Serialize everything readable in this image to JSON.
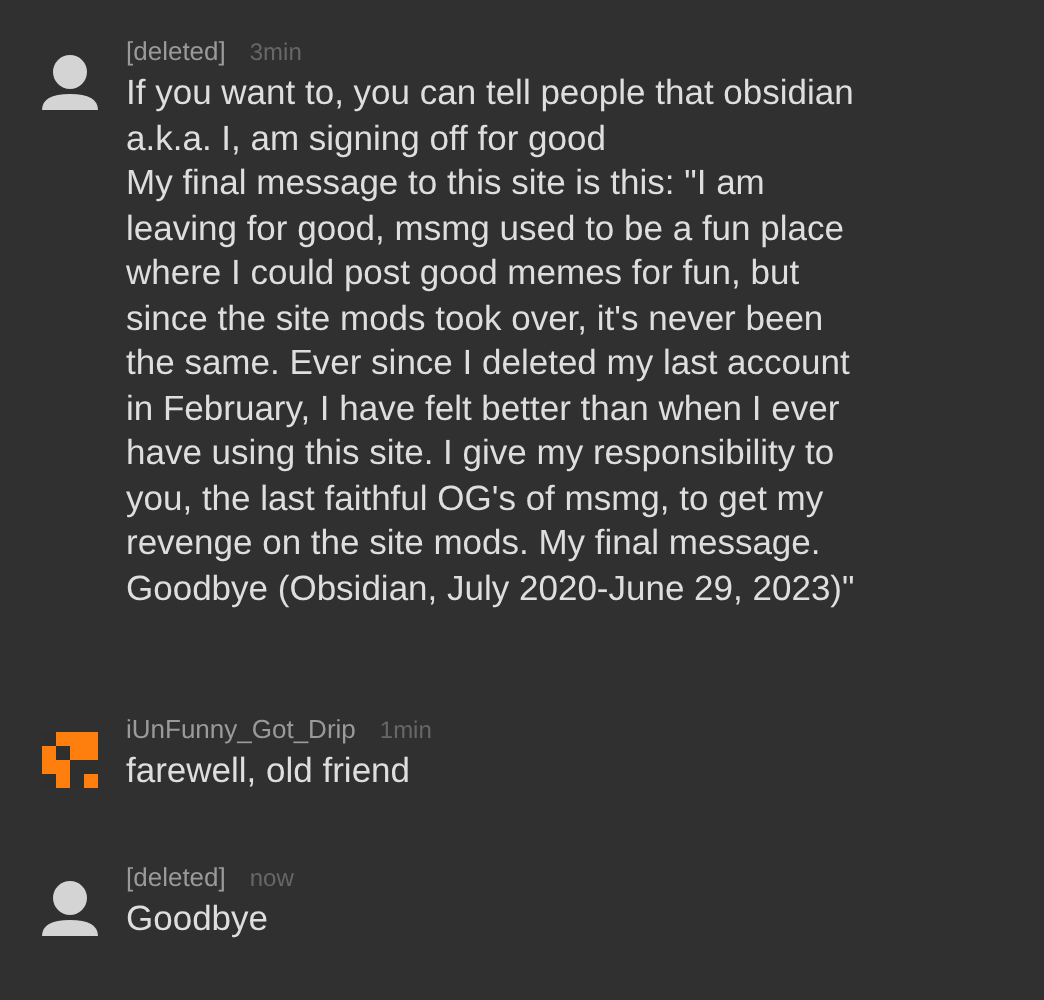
{
  "comments": [
    {
      "kind": "default",
      "username": "[deleted]",
      "time": "3min",
      "body": "If you want to, you can tell people that obsidian\na.k.a. I, am signing off for good\nMy final message to this site is this: \"I am\nleaving for good, msmg used to be a fun place\nwhere I could post good memes for fun, but\nsince the site mods took over, it's never been\nthe same. Ever since I deleted my last account\nin February, I have felt better than when I ever\nhave using this site. I give my responsibility to\nyou, the last faithful OG's of msmg, to get my\nrevenge on the site mods. My final message.\nGoodbye (Obsidian, July 2020-June 29, 2023)\""
    },
    {
      "kind": "pixel",
      "username": "iUnFunny_Got_Drip",
      "time": "1min",
      "body": "farewell, old friend"
    },
    {
      "kind": "default",
      "username": "[deleted]",
      "time": "now",
      "body": "Goodbye"
    }
  ]
}
